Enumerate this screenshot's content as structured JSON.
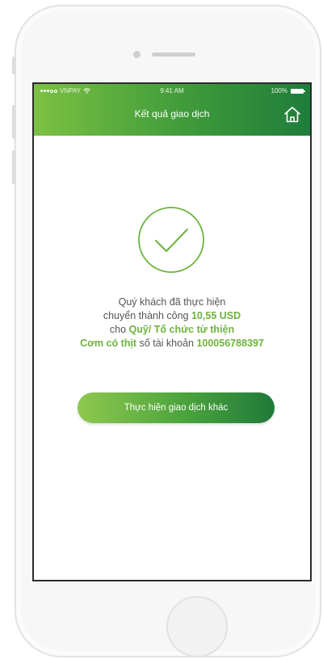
{
  "status_bar": {
    "carrier": "VNPAY",
    "time": "9:41 AM",
    "battery": "100%"
  },
  "header": {
    "title": "Kết quả giao dịch",
    "home_icon": "home-icon"
  },
  "result": {
    "icon": "checkmark-circle-icon",
    "line1": "Quý khách đã thực hiện",
    "line2_prefix": "chuyển thành công ",
    "amount": "10,55 USD",
    "line3_prefix": "cho ",
    "recipient": "Quỹ/ Tổ chức từ thiện",
    "recipient_name": "Cơm có thịt",
    "account_label": " số tài khoản ",
    "account_number": "100056788397"
  },
  "actions": {
    "new_transaction_label": "Thực hiện giao dịch khác"
  },
  "colors": {
    "accent_green": "#6db33f",
    "header_dark_green": "#1f7d3b",
    "header_light_green": "#7cc142",
    "text_gray": "#555555"
  }
}
